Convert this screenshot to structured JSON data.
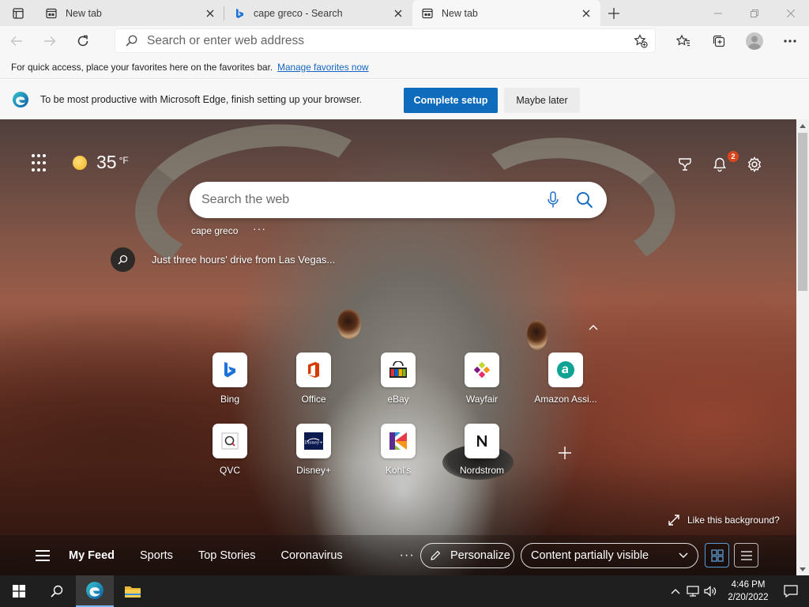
{
  "tabs": [
    {
      "title": "New tab",
      "icon": "new-tab-page-icon",
      "active": false
    },
    {
      "title": "cape greco - Search",
      "icon": "bing-icon",
      "active": false
    },
    {
      "title": "New tab",
      "icon": "new-tab-page-icon",
      "active": true
    }
  ],
  "address": {
    "placeholder": "Search or enter web address",
    "value": ""
  },
  "favorites_bar": {
    "message": "For quick access, place your favorites here on the favorites bar.",
    "link": "Manage favorites now"
  },
  "setup_banner": {
    "message": "To be most productive with Microsoft Edge, finish setting up your browser.",
    "primary": "Complete setup",
    "secondary": "Maybe later"
  },
  "weather": {
    "temp": "35",
    "unit": "°F",
    "icon": "sun-icon"
  },
  "notifications": {
    "count": "2"
  },
  "search": {
    "placeholder": "Search the web"
  },
  "recent_search": "cape greco",
  "recent_more": "···",
  "headline": "Just three hours' drive from Las Vegas...",
  "quick_links": [
    {
      "label": "Bing",
      "icon": "bing-icon"
    },
    {
      "label": "Office",
      "icon": "office-icon"
    },
    {
      "label": "eBay",
      "icon": "ebay-icon"
    },
    {
      "label": "Wayfair",
      "icon": "wayfair-icon"
    },
    {
      "label": "Amazon Assi...",
      "icon": "amazon-assistant-icon"
    },
    {
      "label": "QVC",
      "icon": "qvc-icon"
    },
    {
      "label": "Disney+",
      "icon": "disney-plus-icon"
    },
    {
      "label": "Kohl's",
      "icon": "kohls-icon"
    },
    {
      "label": "Nordstrom",
      "icon": "nordstrom-icon"
    }
  ],
  "like_background": "Like this background?",
  "feed": {
    "tabs": [
      "My Feed",
      "Sports",
      "Top Stories",
      "Coronavirus"
    ],
    "more": "···",
    "personalize": "Personalize",
    "content_visibility": "Content partially visible"
  },
  "clock": {
    "time": "4:46 PM",
    "date": "2/20/2022"
  },
  "colors": {
    "accent": "#0f6cbd",
    "link": "#1565c0",
    "badge": "#d9461e",
    "taskbar": "#1f1f1f"
  }
}
